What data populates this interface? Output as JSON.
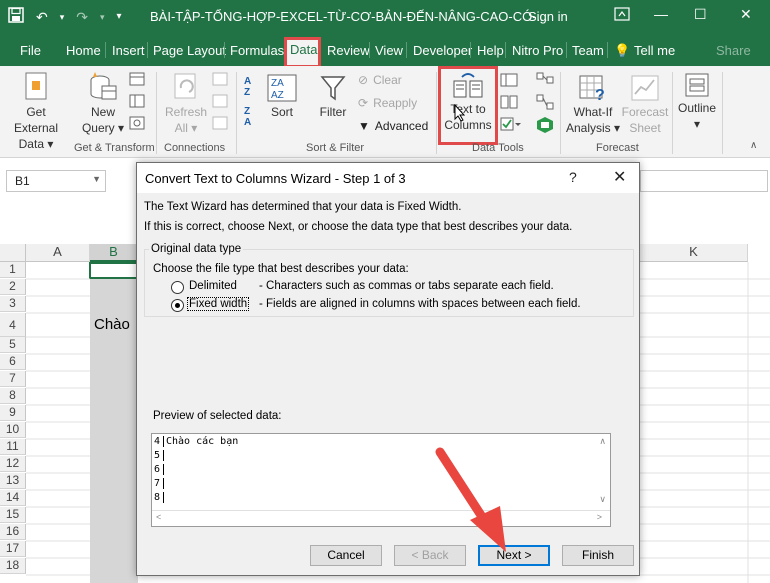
{
  "window": {
    "title": "BÀI-TẬP-TỔNG-HỢP-EXCEL-TỪ-CƠ-BẢN-ĐẾN-NÂNG-CAO-CÓ-...",
    "sign_in": "Sign in",
    "minimize": "—",
    "restore": "☐",
    "close": "✕"
  },
  "qat": {
    "save_icon": "save-icon",
    "undo_icon": "undo-icon",
    "redo_icon": "redo-icon",
    "customize": "▾"
  },
  "tabs": [
    "File",
    "Home",
    "Insert",
    "Page Layout",
    "Formulas",
    "Data",
    "Review",
    "View",
    "Developer",
    "Help",
    "Nitro Pro",
    "Team",
    "Tell me",
    "Share"
  ],
  "ribbon": {
    "get_external": {
      "line1": "Get External",
      "line2": "Data ▾"
    },
    "new_query": {
      "line1": "New",
      "line2": "Query ▾"
    },
    "refresh_all": {
      "line1": "Refresh",
      "line2": "All ▾"
    },
    "sort": "Sort",
    "filter": "Filter",
    "clear": "Clear",
    "reapply": "Reapply",
    "advanced": "Advanced",
    "text_to_columns": {
      "line1": "Text to",
      "line2": "Columns"
    },
    "what_if": {
      "line1": "What-If",
      "line2": "Analysis ▾"
    },
    "forecast_sheet": {
      "line1": "Forecast",
      "line2": "Sheet"
    },
    "outline": {
      "line1": "Outline",
      "line2": "▾"
    },
    "groups": [
      "Get & Transform",
      "Connections",
      "Sort & Filter",
      "Data Tools",
      "Forecast"
    ]
  },
  "name_box": "B1",
  "columns": [
    "A",
    "B",
    "K"
  ],
  "rows": [
    "1",
    "2",
    "3",
    "4",
    "5",
    "6",
    "7",
    "8",
    "9",
    "10",
    "11",
    "12",
    "13",
    "14",
    "15",
    "16",
    "17",
    "18"
  ],
  "cell_b4": "Chào",
  "dialog": {
    "title": "Convert Text to Columns Wizard - Step 1 of 3",
    "help": "?",
    "close": "✕",
    "line1": "The Text Wizard has determined that your data is Fixed Width.",
    "line2": "If this is correct, choose Next, or choose the data type that best describes your data.",
    "group_label": "Original data type",
    "choose_label": "Choose the file type that best describes your data:",
    "option1": {
      "label": "Delimited",
      "desc": "- Characters such as commas or tabs separate each field."
    },
    "option2": {
      "label": "Fixed width",
      "desc": "- Fields are aligned in columns with spaces between each field."
    },
    "preview_label": "Preview of selected data:",
    "preview_rows": [
      {
        "num": "4",
        "text": "Chào các bạn"
      },
      {
        "num": "5",
        "text": ""
      },
      {
        "num": "6",
        "text": ""
      },
      {
        "num": "7",
        "text": ""
      },
      {
        "num": "8",
        "text": ""
      }
    ],
    "buttons": {
      "cancel": "Cancel",
      "back": "< Back",
      "next": "Next >",
      "finish": "Finish"
    }
  },
  "colors": {
    "excel_green": "#217346",
    "highlight_red": "#e04a4a",
    "default_button": "#0078d7"
  }
}
